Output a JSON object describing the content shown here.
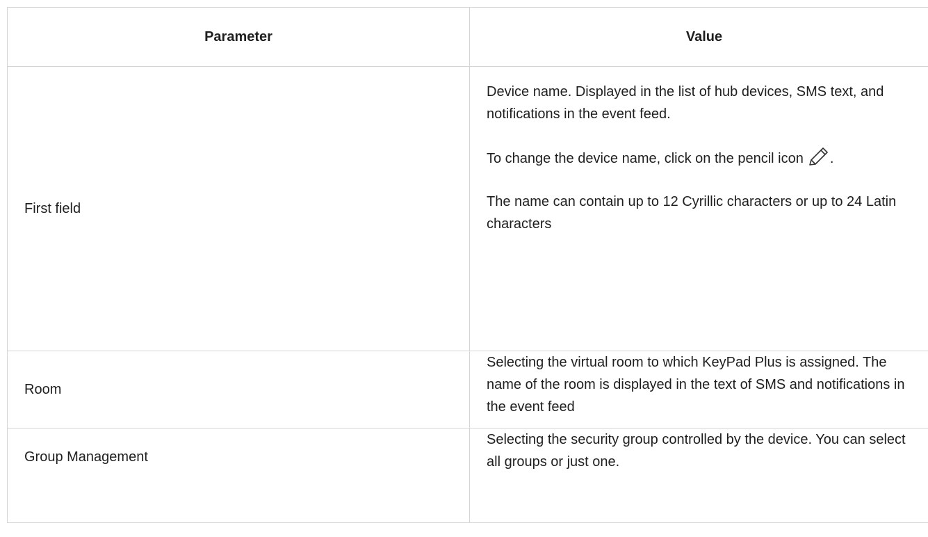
{
  "table": {
    "headers": {
      "parameter": "Parameter",
      "value": "Value"
    },
    "rows": [
      {
        "parameter": "First field",
        "value_paragraphs": [
          "Device name. Displayed in the list of hub devices, SMS text, and notifications in the event feed.",
          "To change the device name, click on the pencil icon",
          "The name can contain up to 12 Cyrillic characters or up to 24 Latin characters"
        ],
        "icon_suffix": ".",
        "icon": "pencil-icon"
      },
      {
        "parameter": "Room",
        "value": "Selecting the virtual room to which KeyPad Plus is assigned. The name of the room is displayed in the text of SMS and notifications in the event feed"
      },
      {
        "parameter": "Group Management",
        "value": "Selecting the security group controlled by the device. You can select all groups or just one."
      }
    ]
  }
}
